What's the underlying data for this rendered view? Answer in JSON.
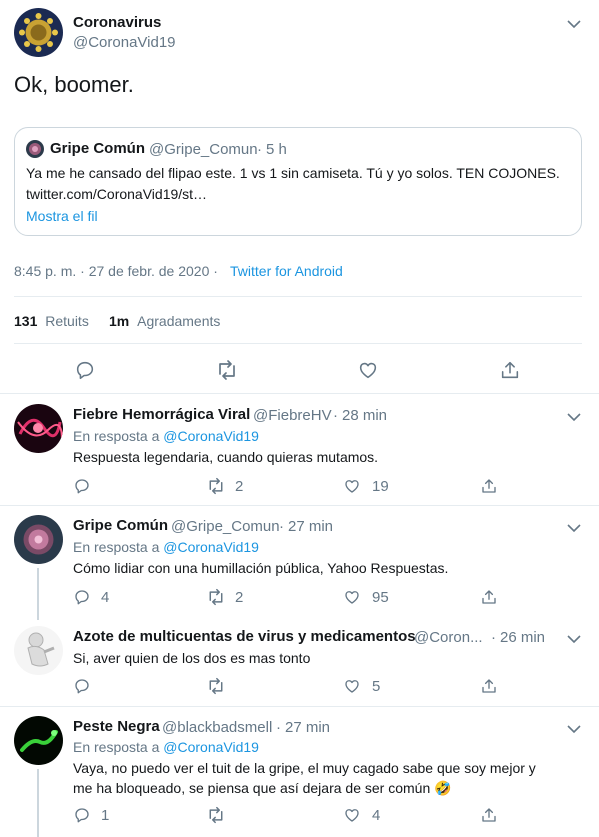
{
  "main_tweet": {
    "name": "Coronavirus",
    "handle": "@CoronaVid19",
    "text": "Ok, boomer.",
    "quote": {
      "name": "Gripe Común",
      "handle": "@Gripe_Comun",
      "sep": "·",
      "time": "5 h",
      "text_line1": "Ya me he cansado del flipao este. 1 vs 1 sin camiseta. Tú y yo solos. TEN COJONES.",
      "text_line2": "twitter.com/CoronaVid19/st…",
      "show_thread": "Mostra el fil"
    },
    "meta_time": "8:45 p. m. · 27 de febr. de 2020 ·",
    "meta_source": "Twitter for Android",
    "retweets_count": "131",
    "retweets_label": "Retuits",
    "likes_count": "1m",
    "likes_label": "Agradaments"
  },
  "replies": [
    {
      "name": "Fiebre Hemorrágica Viral",
      "handle": "@FiebreHV",
      "sep": "·",
      "time": "28 min",
      "reply_prefix": "En resposta a",
      "reply_to": "@CoronaVid19",
      "text": "Respuesta legendaria, cuando quieras mutamos.",
      "replies": "",
      "retweets": "2",
      "likes": "19"
    },
    {
      "name": "Gripe Común",
      "handle": "@Gripe_Comun",
      "sep": "·",
      "time": "27 min",
      "reply_prefix": "En resposta a",
      "reply_to": "@CoronaVid19",
      "text": "Cómo lidiar con una humillación pública, Yahoo Respuestas.",
      "replies": "4",
      "retweets": "2",
      "likes": "95"
    },
    {
      "name": "Azote de multicuentas de virus y medicamentos",
      "handle": "@Coron...",
      "sep": "·",
      "time": "26 min",
      "text": "Si, aver quien de los dos es mas tonto",
      "replies": "",
      "retweets": "",
      "likes": "5"
    },
    {
      "name": "Peste Negra",
      "handle": "@blackbadsmell",
      "sep": "·",
      "time": "27 min",
      "reply_prefix": "En resposta a",
      "reply_to": "@CoronaVid19",
      "text_line1": "Vaya, no puedo ver el tuit de la gripe, el muy cagado sabe que soy mejor y",
      "text_line2": "me ha bloqueado, se piensa que así dejara de ser común",
      "emoji": "🤣",
      "replies": "1",
      "retweets": "",
      "likes": "4"
    }
  ],
  "colors": {
    "link": "#1b95e0",
    "muted": "#657786",
    "divider": "#e6ecf0",
    "text": "#14171a"
  },
  "icons": [
    "chevron-down-icon",
    "reply-icon",
    "retweet-icon",
    "like-icon",
    "share-icon"
  ]
}
